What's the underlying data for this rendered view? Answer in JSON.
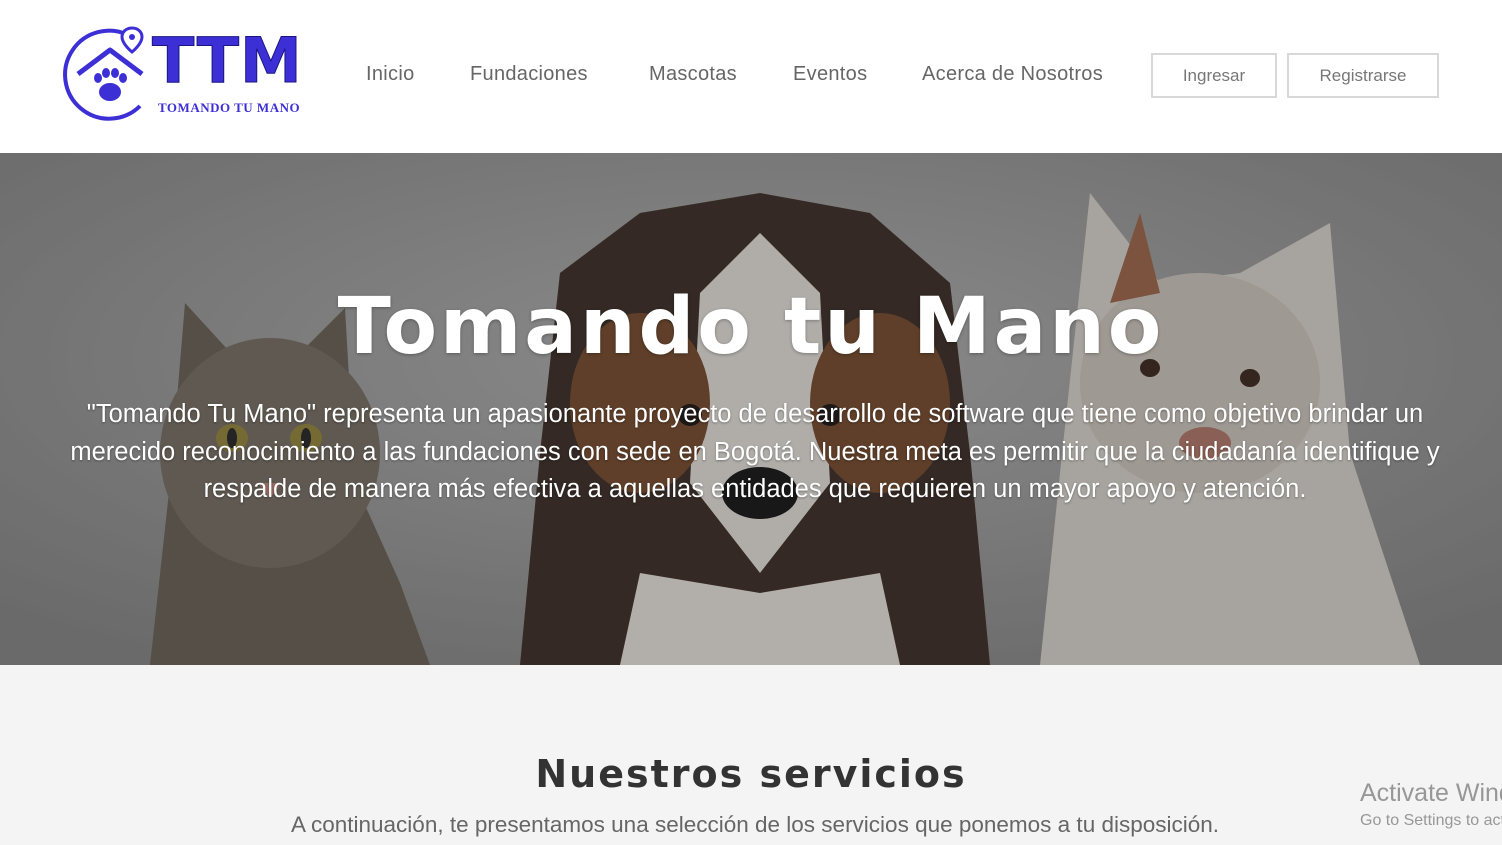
{
  "header": {
    "logo_text": "TTM",
    "logo_subtext": "TOMANDO TU MANO",
    "nav": [
      {
        "label": "Inicio"
      },
      {
        "label": "Fundaciones"
      },
      {
        "label": "Mascotas"
      },
      {
        "label": "Eventos"
      },
      {
        "label": "Acerca de Nosotros"
      }
    ],
    "login_label": "Ingresar",
    "register_label": "Registrarse"
  },
  "hero": {
    "title": "Tomando tu Mano",
    "description": "\"Tomando Tu Mano\" representa un apasionante proyecto de desarrollo de software que tiene como objetivo brindar un merecido reconocimiento a las fundaciones con sede en Bogotá. Nuestra meta es permitir que la ciudadanía identifique y respalde de manera más efectiva a aquellas entidades que requieren un mayor apoyo y atención."
  },
  "services": {
    "title": "Nuestros servicios",
    "subtitle": "A continuación, te presentamos una selección de los servicios que ponemos a tu disposición."
  },
  "watermark": {
    "line1": "Activate Windows",
    "line2": "Go to Settings to activate Windows."
  },
  "colors": {
    "brand": "#3d2fd6",
    "nav_text": "#666666",
    "services_bg": "#f4f4f4"
  }
}
